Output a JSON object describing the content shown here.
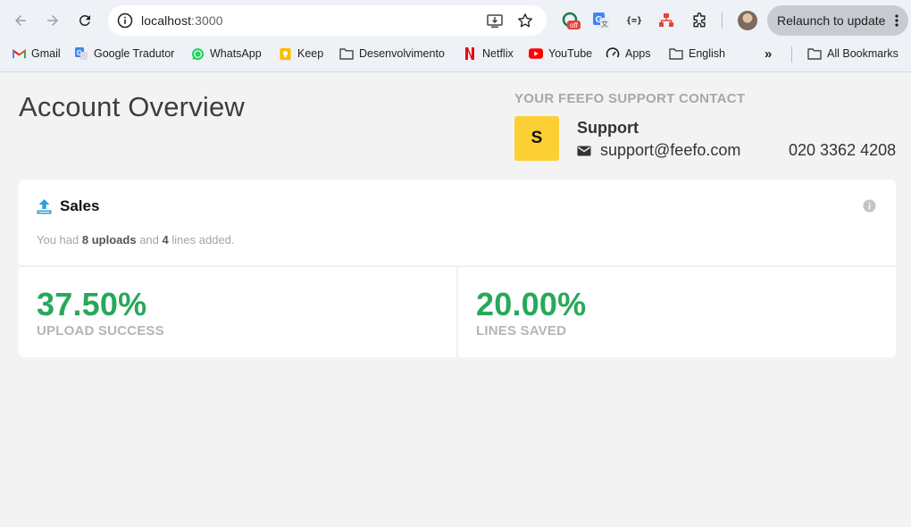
{
  "browser": {
    "url_host": "localhost",
    "url_port": ":3000",
    "relaunch_label": "Relaunch to update",
    "extensions": [
      {
        "name": "off-badge-extension",
        "badge": "off"
      },
      {
        "name": "google-translate-extension"
      },
      {
        "name": "json-viewer-extension",
        "label": "{=}"
      },
      {
        "name": "org-chart-extension"
      },
      {
        "name": "extensions-puzzle"
      }
    ],
    "bookmarks": [
      {
        "label": "Gmail",
        "icon": "gmail-icon"
      },
      {
        "label": "Google Tradutor",
        "icon": "google-translate-icon"
      },
      {
        "label": "WhatsApp",
        "icon": "whatsapp-icon"
      },
      {
        "label": "Keep",
        "icon": "keep-icon"
      },
      {
        "label": "Desenvolvimento",
        "icon": "folder-icon"
      },
      {
        "label": "Netflix",
        "icon": "netflix-icon"
      },
      {
        "label": "YouTube",
        "icon": "youtube-icon"
      },
      {
        "label": "Apps",
        "icon": "apps-gauge-icon"
      },
      {
        "label": "English",
        "icon": "folder-icon"
      },
      {
        "label": "All Bookmarks",
        "icon": "folder-icon"
      }
    ]
  },
  "page": {
    "title": "Account Overview",
    "contact": {
      "heading": "YOUR FEEFO SUPPORT CONTACT",
      "initial": "S",
      "name": "Support",
      "email": "support@feefo.com",
      "phone": "020 3362 4208"
    },
    "sales_card": {
      "title": "Sales",
      "summary_prefix": "You had",
      "uploads": "8 uploads",
      "summary_mid": "and",
      "lines": "4",
      "summary_suffix": "lines added.",
      "stats": [
        {
          "value": "37.50%",
          "label": "UPLOAD SUCCESS"
        },
        {
          "value": "20.00%",
          "label": "LINES SAVED"
        }
      ]
    }
  },
  "colors": {
    "accent_green": "#28a85a",
    "avatar_yellow": "#fcd034",
    "upload_icon_blue": "#2f9fdd"
  }
}
